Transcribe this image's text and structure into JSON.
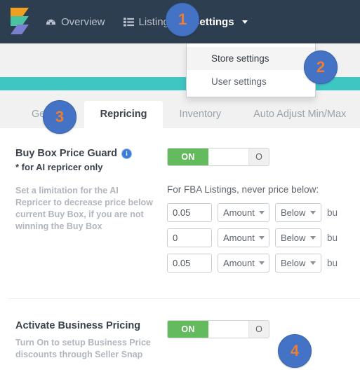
{
  "navbar": {
    "brand_icon": "sellersnap-logo",
    "items": [
      {
        "label": "Overview",
        "icon": "dashboard-icon",
        "active": false
      },
      {
        "label": "Listings",
        "icon": "list-icon",
        "active": false
      },
      {
        "label": "Settings",
        "icon": "caret-down-icon",
        "active": true
      }
    ]
  },
  "dropdown": {
    "items": [
      {
        "label": "Store settings",
        "hovered": true
      },
      {
        "label": "User settings",
        "hovered": false
      }
    ]
  },
  "tabs": [
    {
      "label": "General",
      "active": false
    },
    {
      "label": "Repricing",
      "active": true
    },
    {
      "label": "Inventory",
      "active": false
    },
    {
      "label": "Auto Adjust Min/Max",
      "active": false
    }
  ],
  "buy_box_guard": {
    "title": "Buy Box Price Guard",
    "info_icon": "info-icon",
    "subtitle": "* for AI repricer only",
    "description": "Set a limitation for the AI Repricer to decrease price below current Buy Box, if you are not winning the Buy Box",
    "toggle": {
      "on_label": "ON",
      "off_label": "O"
    },
    "fba_label": "For FBA Listings, never price below:",
    "rows": [
      {
        "value": "0.05",
        "amount": "Amount",
        "direction": "Below",
        "suffix": "bu"
      },
      {
        "value": "0",
        "amount": "Amount",
        "direction": "Below",
        "suffix": "bu"
      },
      {
        "value": "0.05",
        "amount": "Amount",
        "direction": "Below",
        "suffix": "bu"
      }
    ]
  },
  "business_pricing": {
    "title": "Activate Business Pricing",
    "description": "Turn On to setup Business Price discounts through Seller Snap",
    "toggle": {
      "on_label": "ON",
      "off_label": "O"
    }
  },
  "callouts": [
    {
      "number": "1"
    },
    {
      "number": "2"
    },
    {
      "number": "3"
    },
    {
      "number": "4"
    }
  ],
  "colors": {
    "navbar_bg": "#2d3e50",
    "teal_bar": "#3ec6c3",
    "toggle_on": "#64bb5d",
    "badge_bg": "#4472c4",
    "badge_text": "#ed7d31",
    "page_bg": "#f1f1f1"
  }
}
